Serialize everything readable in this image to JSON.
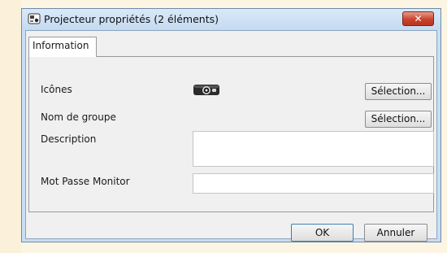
{
  "window": {
    "title": "Projecteur propriétés (2 éléments)",
    "close_icon": "close-icon",
    "app_icon": "projector-properties-icon"
  },
  "tabs": [
    {
      "label": "Information",
      "active": true
    }
  ],
  "form": {
    "icons_label": "Icônes",
    "icons_button": "Sélection...",
    "icon_preview": "projector-icon",
    "group_label": "Nom de groupe",
    "group_button": "Sélection...",
    "description_label": "Description",
    "description_value": "",
    "monitor_password_label": "Mot Passe Monitor",
    "monitor_password_value": ""
  },
  "footer": {
    "ok_label": "OK",
    "cancel_label": "Annuler"
  },
  "colors": {
    "title_bar": "#c9def3",
    "close_button": "#c9432d",
    "background": "#fdf5e3"
  }
}
